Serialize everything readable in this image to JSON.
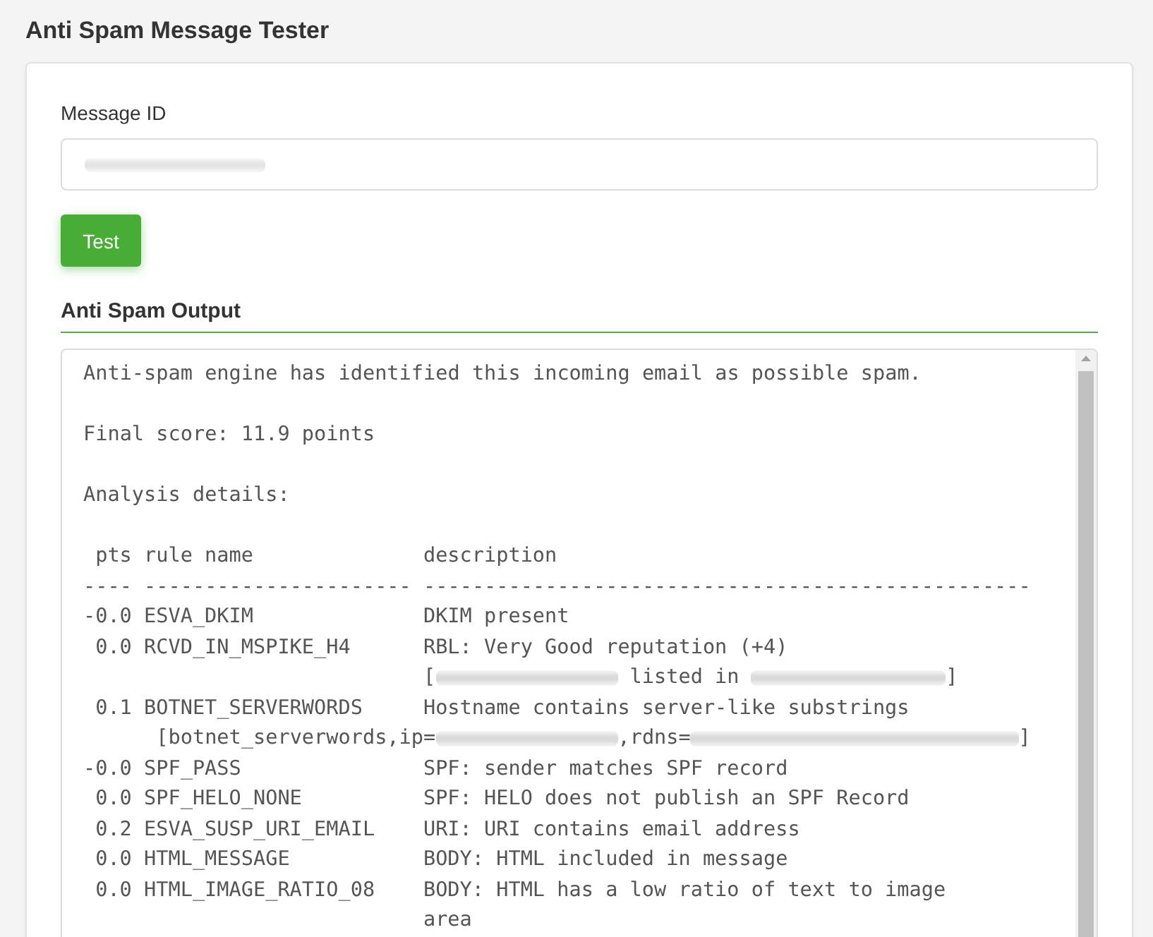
{
  "page": {
    "title": "Anti Spam Message Tester"
  },
  "form": {
    "message_id": {
      "label": "Message ID",
      "value_redacted": true
    },
    "button": "Test"
  },
  "output": {
    "heading": "Anti Spam Output",
    "summary": "Anti-spam engine has identified this incoming email as possible spam.",
    "score": "Final score: 11.9 points",
    "details_heading": "Analysis details:",
    "columns": [
      "pts",
      "rule name",
      "description"
    ],
    "separator": "---- ---------------------- --------------------------------------------------",
    "rules": [
      {
        "pts": "-0.0",
        "name": "ESVA_DKIM",
        "description": [
          "DKIM present"
        ]
      },
      {
        "pts": "0.0",
        "name": "RCVD_IN_MSPIKE_H4",
        "description": [
          "RBL: Very Good reputation (+4)"
        ],
        "detail": {
          "kind": "wrapped",
          "segments": [
            {
              "kind": "text",
              "text": "["
            },
            {
              "kind": "ip"
            },
            {
              "kind": "text",
              "text": " listed in "
            },
            {
              "kind": "list-domain"
            },
            {
              "kind": "text",
              "text": "]"
            }
          ]
        }
      },
      {
        "pts": "0.1",
        "name": "BOTNET_SERVERWORDS",
        "description": [
          "Hostname contains server-like substrings"
        ],
        "detail": {
          "kind": "indented",
          "segments": [
            {
              "kind": "text",
              "text": "[botnet_serverwords,ip="
            },
            {
              "kind": "ip"
            },
            {
              "kind": "text",
              "text": ",rdns="
            },
            {
              "kind": "hostname"
            },
            {
              "kind": "text",
              "text": "]"
            }
          ]
        }
      },
      {
        "pts": "-0.0",
        "name": "SPF_PASS",
        "description": [
          "SPF: sender matches SPF record"
        ]
      },
      {
        "pts": "0.0",
        "name": "SPF_HELO_NONE",
        "description": [
          "SPF: HELO does not publish an SPF Record"
        ]
      },
      {
        "pts": "0.2",
        "name": "ESVA_SUSP_URI_EMAIL",
        "description": [
          "URI: URI contains email address"
        ]
      },
      {
        "pts": "0.0",
        "name": "HTML_MESSAGE",
        "description": [
          "BODY: HTML included in message"
        ]
      },
      {
        "pts": "0.0",
        "name": "HTML_IMAGE_RATIO_08",
        "description": [
          "BODY: HTML has a low ratio of text to image",
          "area"
        ]
      }
    ]
  }
}
